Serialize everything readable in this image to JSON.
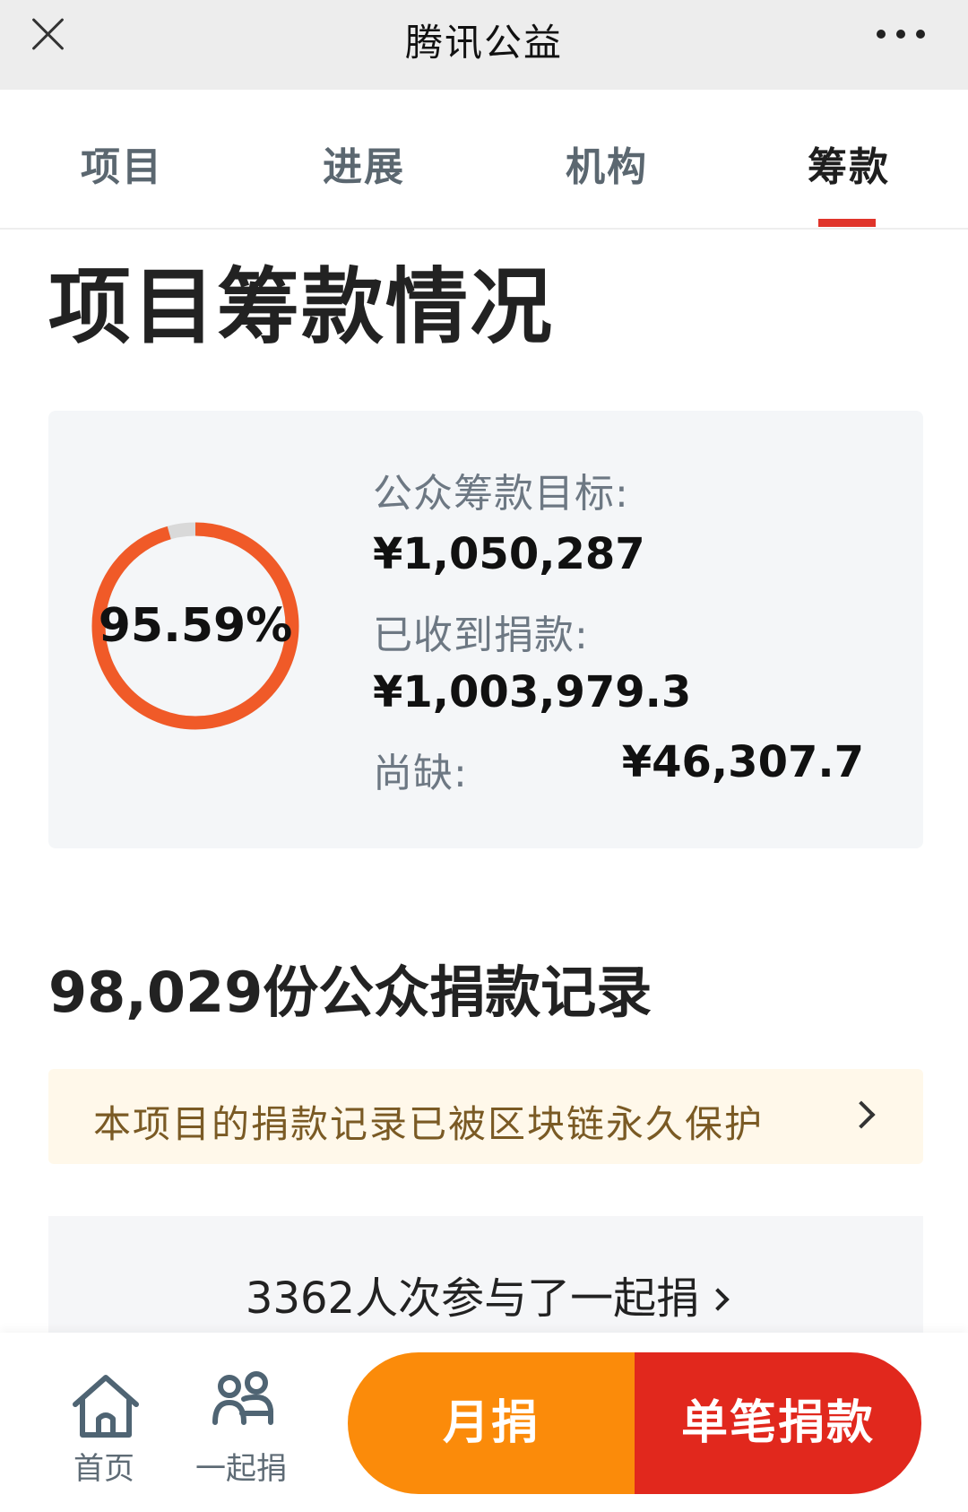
{
  "app": {
    "title": "腾讯公益"
  },
  "icons": {
    "close": "close-icon",
    "more": "more-dots-icon",
    "home": "home-icon",
    "together": "people-icon",
    "chevron": "chevron-right-icon"
  },
  "tabs": [
    {
      "label": "项目",
      "active": false
    },
    {
      "label": "进展",
      "active": false
    },
    {
      "label": "机构",
      "active": false
    },
    {
      "label": "筹款",
      "active": true
    }
  ],
  "section_title": "项目筹款情况",
  "stats": {
    "progress_percent": 95.59,
    "progress_label": "95.59%",
    "target_label": "公众筹款目标:",
    "target_value": "¥1,050,287",
    "received_label": "已收到捐款:",
    "received_value": "¥1,003,979.3",
    "shortfall_label": "尚缺:",
    "shortfall_value": "¥46,307.7"
  },
  "records_title": "98,029份公众捐款记录",
  "chain_notice": "本项目的捐款记录已被区块链永久保护",
  "together": {
    "text": "3362人次参与了一起捐"
  },
  "bottom_nav": {
    "home_label": "首页",
    "together_label": "一起捐",
    "monthly_label": "月捐",
    "single_label": "单笔捐款"
  },
  "colors": {
    "accent_red": "#e1281d",
    "accent_orange": "#fb8b0a",
    "ring_progress": "#f05a28",
    "ring_track": "#d9d9d9",
    "tab_underline": "#e0342a"
  }
}
